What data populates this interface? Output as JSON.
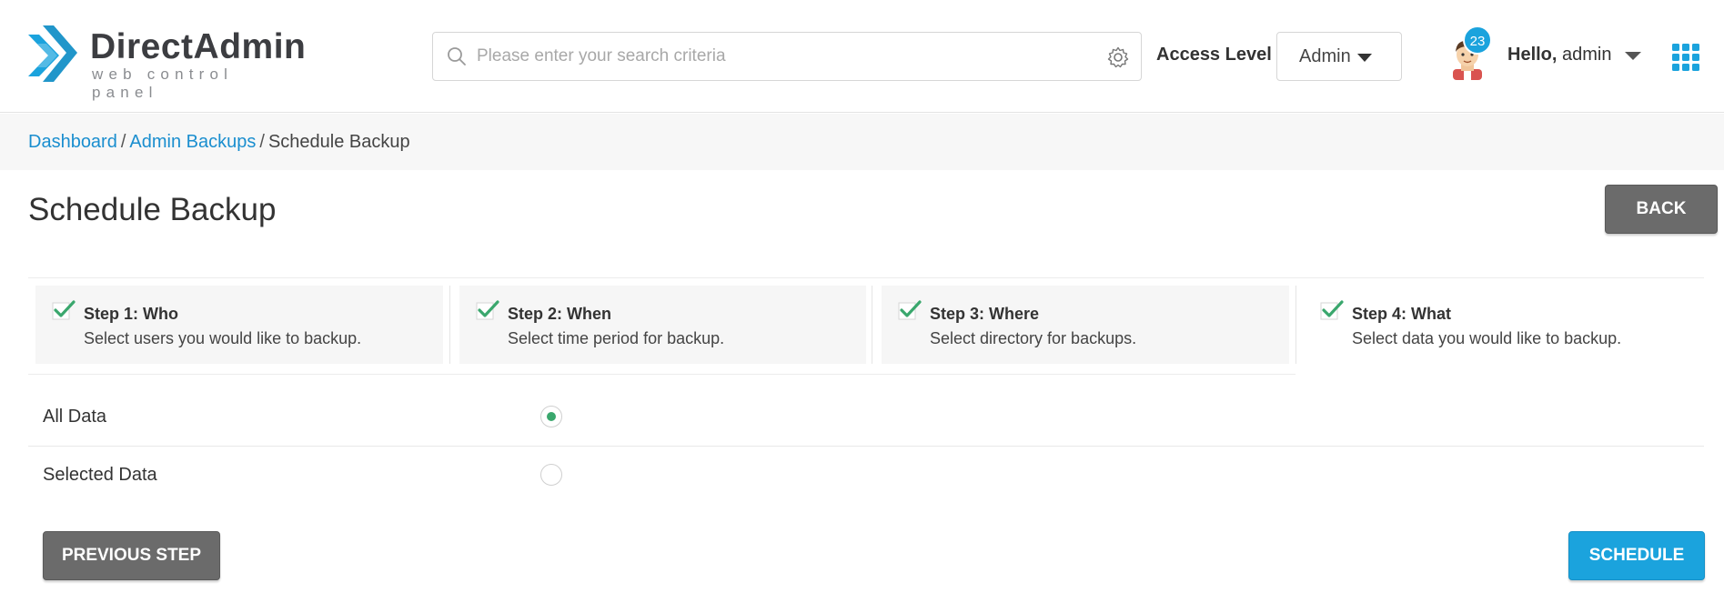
{
  "brand": {
    "name": "DirectAdmin",
    "tagline": "web control panel",
    "logo_icon": "directadmin-chevron-logo",
    "colors": {
      "logo_blue": "#1ba3dd",
      "text_dark": "#3c3d41"
    }
  },
  "header": {
    "search": {
      "placeholder": "Please enter your search criteria",
      "value": "",
      "icon": "search-icon",
      "settings_icon": "gear-icon"
    },
    "access_level": {
      "label": "Access Level",
      "selected": "Admin"
    },
    "user": {
      "greeting": "Hello,",
      "name": "admin",
      "notification_count": "23"
    },
    "apps_icon": "grid-apps-icon"
  },
  "breadcrumb": {
    "items": [
      {
        "label": "Dashboard",
        "link": true
      },
      {
        "label": "Admin Backups",
        "link": true
      },
      {
        "label": "Schedule Backup",
        "link": false
      }
    ],
    "separator": "/"
  },
  "page": {
    "title": "Schedule Backup",
    "back_label": "BACK"
  },
  "steps": [
    {
      "title": "Step 1: Who",
      "description": "Select users you would like to backup.",
      "completed": true
    },
    {
      "title": "Step 2: When",
      "description": "Select time period for backup.",
      "completed": true
    },
    {
      "title": "Step 3: Where",
      "description": "Select directory for backups.",
      "completed": true
    },
    {
      "title": "Step 4: What",
      "description": "Select data you would like to backup.",
      "completed": true,
      "current": true
    }
  ],
  "options": [
    {
      "label": "All Data",
      "selected": true
    },
    {
      "label": "Selected Data",
      "selected": false
    }
  ],
  "actions": {
    "previous_label": "PREVIOUS STEP",
    "schedule_label": "SCHEDULE"
  },
  "colors": {
    "accent": "#1ba3dd",
    "link": "#1a8ecf",
    "check_green": "#3aa76d",
    "secondary_button": "#6b6b6b"
  }
}
